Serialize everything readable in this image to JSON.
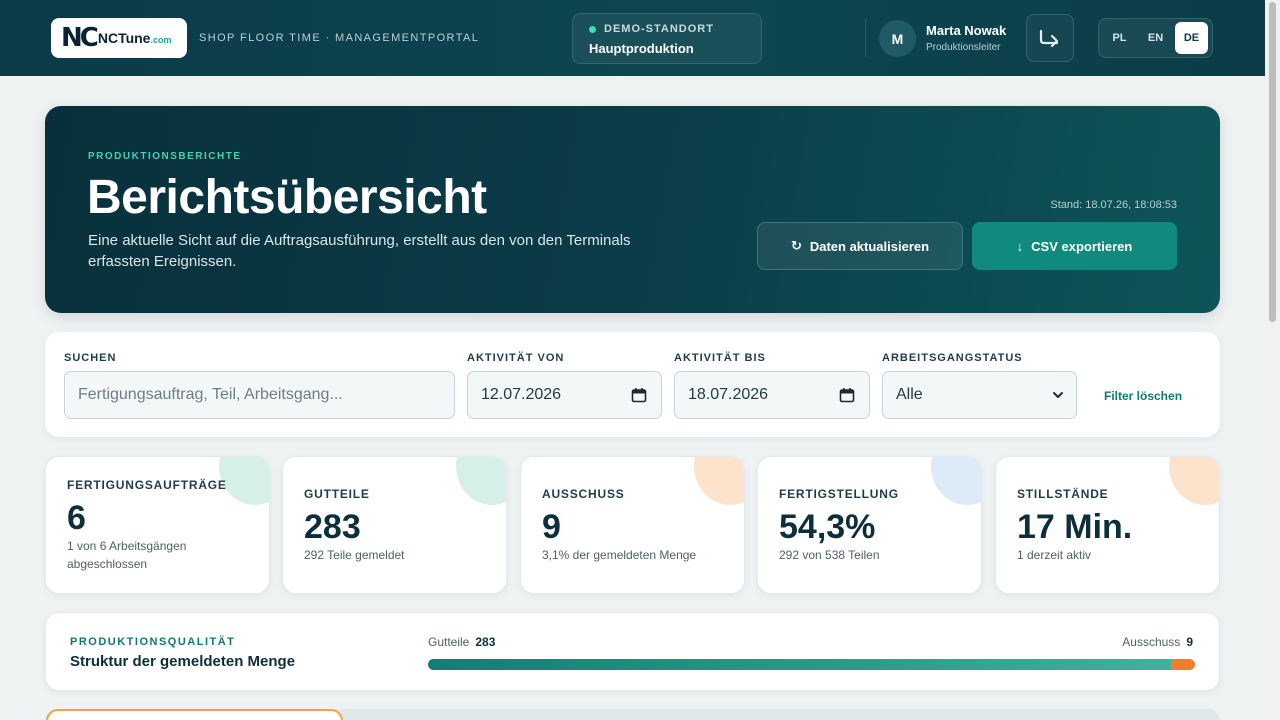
{
  "header": {
    "logo_text": "NCTune",
    "logo_tld": ".com",
    "portal": "SHOP FLOOR TIME · MANAGEMENTPORTAL",
    "site_label": "DEMO-STANDORT",
    "site_value": "Hauptproduktion",
    "user_initial": "M",
    "user_name": "Marta Nowak",
    "user_role": "Produktionsleiter",
    "languages": [
      "PL",
      "EN",
      "DE"
    ],
    "active_language": "DE"
  },
  "hero": {
    "eyebrow": "PRODUKTIONSBERICHTE",
    "title": "Berichtsübersicht",
    "description": "Eine aktuelle Sicht auf die Auftragsausführung, erstellt aus den von den Terminals erfassten Ereignissen.",
    "stamp": "Stand: 18.07.26, 18:08:53",
    "refresh_label": "Daten aktualisieren",
    "export_label": "CSV exportieren"
  },
  "filters": {
    "search_label": "SUCHEN",
    "search_placeholder": "Fertigungsauftrag, Teil, Arbeitsgang...",
    "from_label": "AKTIVITÄT VON",
    "from_value": "12.07.2026",
    "to_label": "AKTIVITÄT BIS",
    "to_value": "18.07.2026",
    "status_label": "ARBEITSGANGSTATUS",
    "status_value": "Alle",
    "clear_label": "Filter löschen"
  },
  "kpis": [
    {
      "label": "FERTIGUNGSAUFTRÄGE",
      "value": "6",
      "sub": "1 von 6 Arbeitsgängen abgeschlossen",
      "accent": "#d6efe7"
    },
    {
      "label": "GUTTEILE",
      "value": "283",
      "sub": "292 Teile gemeldet",
      "accent": "#d6efe7"
    },
    {
      "label": "AUSSCHUSS",
      "value": "9",
      "sub": "3,1% der gemeldeten Menge",
      "accent": "#fde3cc"
    },
    {
      "label": "FERTIGSTELLUNG",
      "value": "54,3%",
      "sub": "292 von 538 Teilen",
      "accent": "#dcebf7"
    },
    {
      "label": "STILLSTÄNDE",
      "value": "17 Min.",
      "sub": "1 derzeit aktiv",
      "accent": "#fde3cc"
    }
  ],
  "quality": {
    "eyebrow": "PRODUKTIONSQUALITÄT",
    "title": "Struktur der gemeldeten Menge",
    "good_label": "Gutteile",
    "good_value": "283",
    "scrap_label": "Ausschuss",
    "scrap_value": "9",
    "good_fraction": 0.969,
    "scrap_fraction": 0.031
  },
  "colors": {
    "header_bg": "#0b3a48",
    "accent_teal": "#0f8a7c",
    "scrap_orange": "#f07e2c"
  }
}
